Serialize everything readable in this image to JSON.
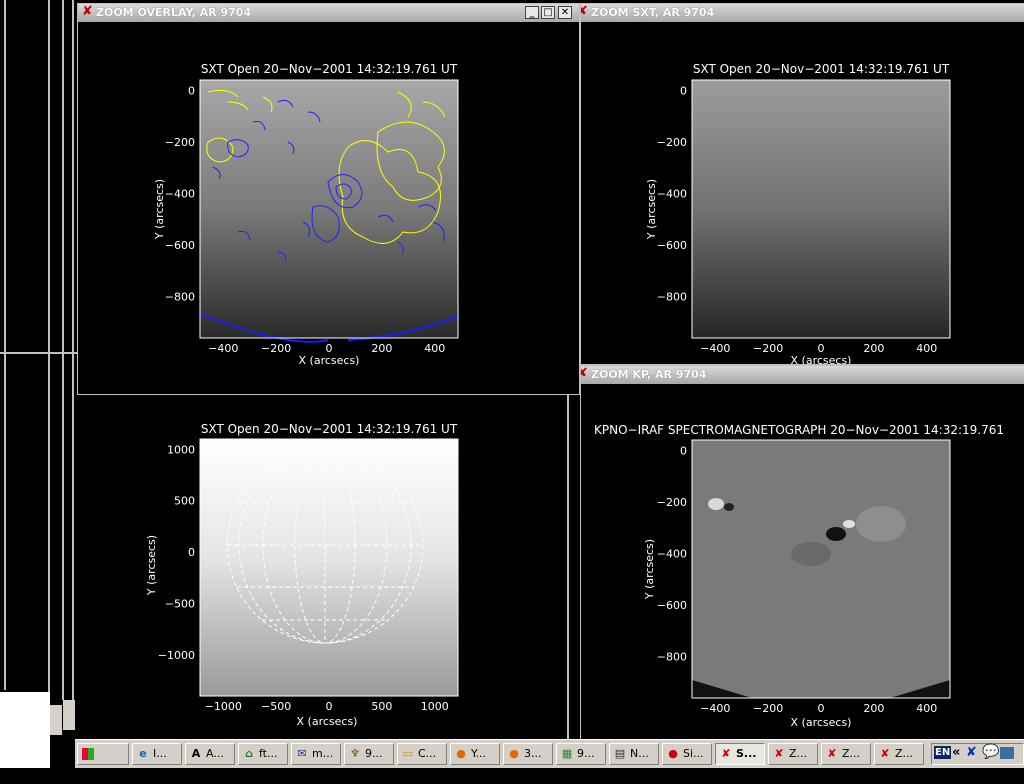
{
  "windows": {
    "overlay": {
      "title": "ZOOM OVERLAY, AR 9704"
    },
    "sxt": {
      "title": "ZOOM SXT, AR 9704"
    },
    "kp": {
      "title": "ZOOM KP, AR 9704"
    }
  },
  "plots": {
    "overlay": {
      "title": "SXT Open 20−Nov−2001 14:32:19.761 UT",
      "xlabel": "X (arcsecs)",
      "ylabel": "Y (arcsecs)",
      "xticks": [
        "−400",
        "−200",
        "0",
        "200",
        "400"
      ],
      "yticks": [
        "0",
        "−200",
        "−400",
        "−600",
        "−800"
      ]
    },
    "sxt": {
      "title": "SXT Open 20−Nov−2001 14:32:19.761 UT",
      "xlabel": "X (arcsecs)",
      "ylabel": "Y (arcsecs)",
      "xticks": [
        "−400",
        "−200",
        "0",
        "200",
        "400"
      ],
      "yticks": [
        "0",
        "−200",
        "−400",
        "−600",
        "−800"
      ]
    },
    "full": {
      "title": "SXT Open 20−Nov−2001 14:32:19.761 UT",
      "xlabel": "X (arcsecs)",
      "ylabel": "Y (arcsecs)",
      "xticks": [
        "−1000",
        "−500",
        "0",
        "500",
        "1000"
      ],
      "yticks": [
        "1000",
        "500",
        "0",
        "−500",
        "−1000"
      ]
    },
    "kp": {
      "title": "KPNO−IRAF SPECTROMAGNETOGRAPH 20−Nov−2001 14:32:19.761",
      "xlabel": "X (arcsecs)",
      "ylabel": "Y (arcsecs)",
      "xticks": [
        "−400",
        "−200",
        "0",
        "200",
        "400"
      ],
      "yticks": [
        "0",
        "−200",
        "−400",
        "−600",
        "−800"
      ]
    }
  },
  "colors": {
    "positive_contour": "#ffff00",
    "negative_contour": "#2222ff",
    "limb": "#1a1aff"
  },
  "taskbar": {
    "start": "Start",
    "items": [
      {
        "label": "I...",
        "icon": "ie-icon"
      },
      {
        "label": "A...",
        "icon": "acrobat-icon"
      },
      {
        "label": "ft...",
        "icon": "ftp-icon"
      },
      {
        "label": "m...",
        "icon": "mail-icon"
      },
      {
        "label": "9...",
        "icon": "app-icon"
      },
      {
        "label": "C...",
        "icon": "folder-icon"
      },
      {
        "label": "Y...",
        "icon": "firefox-icon"
      },
      {
        "label": "3...",
        "icon": "firefox-icon"
      },
      {
        "label": "9...",
        "icon": "image-icon"
      },
      {
        "label": "N...",
        "icon": "notepad-icon"
      },
      {
        "label": "Si...",
        "icon": "stop-icon"
      },
      {
        "label": "S...",
        "icon": "idl-x-icon"
      },
      {
        "label": "Z...",
        "icon": "idl-x-icon"
      },
      {
        "label": "Z...",
        "icon": "idl-x-icon"
      },
      {
        "label": "Z...",
        "icon": "idl-x-icon"
      }
    ],
    "tray": {
      "lang": "EN",
      "chevron": "«"
    }
  }
}
